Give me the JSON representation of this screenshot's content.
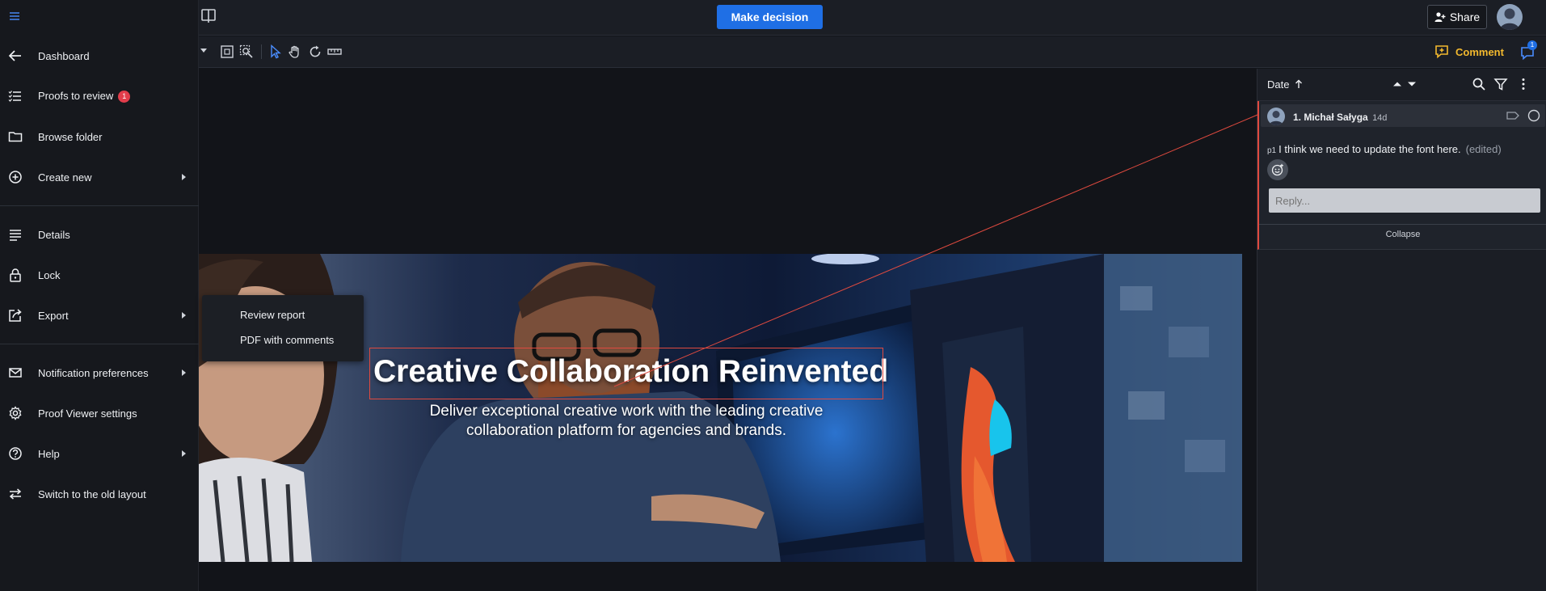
{
  "header": {
    "make_decision_label": "Make decision",
    "share_label": "Share"
  },
  "toolbar": {
    "comment_label": "Comment",
    "comment_count": "1"
  },
  "sidebar": {
    "items": [
      {
        "label": "Dashboard",
        "icon": "arrow-left-icon"
      },
      {
        "label": "Proofs to review",
        "icon": "checklist-icon",
        "badge": "1"
      },
      {
        "label": "Browse folder",
        "icon": "folder-icon"
      },
      {
        "label": "Create new",
        "icon": "plus-circle-icon"
      },
      {
        "label": "Details",
        "icon": "details-lines-icon"
      },
      {
        "label": "Lock",
        "icon": "lock-icon"
      },
      {
        "label": "Export",
        "icon": "export-icon"
      },
      {
        "label": "Notification preferences",
        "icon": "mail-icon"
      },
      {
        "label": "Proof Viewer settings",
        "icon": "gear-icon"
      },
      {
        "label": "Help",
        "icon": "help-circle-icon"
      },
      {
        "label": "Switch to the old layout",
        "icon": "switch-layout-icon"
      }
    ]
  },
  "export_menu": {
    "items": [
      "Review report",
      "PDF with comments"
    ]
  },
  "canvas": {
    "headline": "Creative Collaboration Reinvented",
    "subline": "Deliver exceptional creative work with the leading creative collaboration platform for agencies and brands."
  },
  "comments_panel": {
    "sort_label": "Date",
    "comment": {
      "author": "1. Michał Sałyga",
      "age": "14d",
      "page": "p1",
      "text": "I think we need to update the font here.",
      "edited": "(edited)",
      "reply_placeholder": "Reply...",
      "collapse_label": "Collapse"
    }
  },
  "colors": {
    "accent": "#1f6fe5",
    "comment": "#f3b92e",
    "annotation": "#e04a3f",
    "badge": "#e23d4b"
  }
}
